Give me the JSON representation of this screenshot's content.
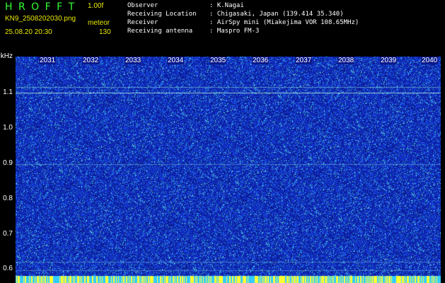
{
  "app": {
    "logo": "H R O F F T",
    "version": "1.00f",
    "filename": "KN9_2508202030.png",
    "mode": "meteor",
    "datetime": "25.08.20 20:30",
    "count": "130"
  },
  "info": [
    {
      "label": "Observer",
      "value": ": K.Nagai"
    },
    {
      "label": "Receiving Location",
      "value": ": Chigasaki, Japan (139.414 35.340)"
    },
    {
      "label": "Receiver",
      "value": ": AirSpy mini (Miakejima VOR 108.65MHz)"
    },
    {
      "label": "Receiving antenna",
      "value": ": Maspro FM-3"
    }
  ],
  "y_axis": {
    "unit": "kHz",
    "ticks": [
      "1.1",
      "1.0",
      "0.9",
      "0.8",
      "0.7",
      "0.6"
    ]
  },
  "x_axis": {
    "ticks": [
      "2031",
      "2032",
      "2033",
      "2034",
      "2035",
      "2036",
      "2037",
      "2038",
      "2039",
      "2040"
    ]
  },
  "colors": {
    "background": "#000000",
    "plot_bg": "#0b1a8c",
    "noise_blue": "#1a3cff",
    "noise_cyan": "#33ccff",
    "noise_yellow": "#ffff33",
    "logo": "#33ff33",
    "accent_text": "#e8e800"
  }
}
